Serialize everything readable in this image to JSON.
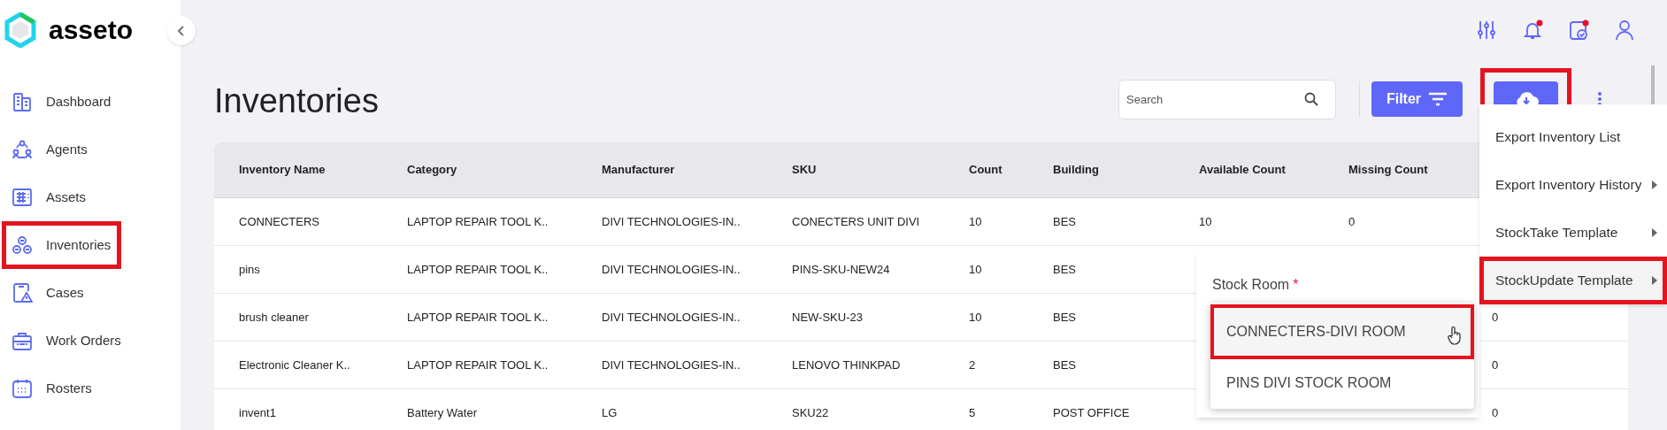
{
  "brand": {
    "name": "asseto"
  },
  "sidebar": {
    "items": [
      {
        "label": "Dashboard",
        "highlighted": false
      },
      {
        "label": "Agents",
        "highlighted": false
      },
      {
        "label": "Assets",
        "highlighted": false
      },
      {
        "label": "Inventories",
        "highlighted": true
      },
      {
        "label": "Cases",
        "highlighted": false
      },
      {
        "label": "Work Orders",
        "highlighted": false
      },
      {
        "label": "Rosters",
        "highlighted": false
      }
    ]
  },
  "header_icons": [
    {
      "kind": "sliders",
      "badge": false
    },
    {
      "kind": "bell",
      "badge": true
    },
    {
      "kind": "clipboard",
      "badge": true
    },
    {
      "kind": "user",
      "badge": false
    }
  ],
  "page_title": "Inventories",
  "search": {
    "placeholder": "Search"
  },
  "filter_button": {
    "label": "Filter"
  },
  "export_button": {
    "highlighted": true
  },
  "table": {
    "columns": [
      "Inventory Name",
      "Category",
      "Manufacturer",
      "SKU",
      "Count",
      "Building",
      "Available Count",
      "Missing Count",
      null
    ],
    "rows": [
      [
        "CONNECTERS",
        "LAPTOP REPAIR TOOL K..",
        "DIVI TECHNOLOGIES-IN..",
        "CONECTERS UNIT DIVI",
        "10",
        "BES",
        "10",
        "0",
        null
      ],
      [
        "pins",
        "LAPTOP REPAIR TOOL K..",
        "DIVI TECHNOLOGIES-IN..",
        "PINS-SKU-NEW24",
        "10",
        "BES",
        null,
        null,
        null
      ],
      [
        "brush cleaner",
        "LAPTOP REPAIR TOOL K..",
        "DIVI TECHNOLOGIES-IN..",
        "NEW-SKU-23",
        "10",
        "BES",
        null,
        null,
        "0"
      ],
      [
        "Electronic Cleaner K..",
        "LAPTOP REPAIR TOOL K..",
        "DIVI TECHNOLOGIES-IN..",
        "LENOVO THINKPAD",
        "2",
        "BES",
        null,
        null,
        "0"
      ],
      [
        "invent1",
        "Battery Water",
        "LG",
        "SKU22",
        "5",
        "POST OFFICE",
        null,
        null,
        "0"
      ]
    ]
  },
  "export_menu": {
    "items": [
      {
        "label": "Export Inventory List",
        "has_submenu": false,
        "highlighted": false
      },
      {
        "label": "Export Inventory History",
        "has_submenu": true,
        "highlighted": false
      },
      {
        "label": "StockTake Template",
        "has_submenu": true,
        "highlighted": false
      },
      {
        "label": "StockUpdate Template",
        "has_submenu": true,
        "highlighted": true
      }
    ]
  },
  "stock_room_popup": {
    "label": "Stock Room",
    "required_mark": "*",
    "options": [
      {
        "label": "CONNECTERS-DIVI ROOM",
        "highlighted": true,
        "hovered": true
      },
      {
        "label": "PINS DIVI STOCK ROOM",
        "highlighted": false,
        "hovered": false
      }
    ]
  }
}
